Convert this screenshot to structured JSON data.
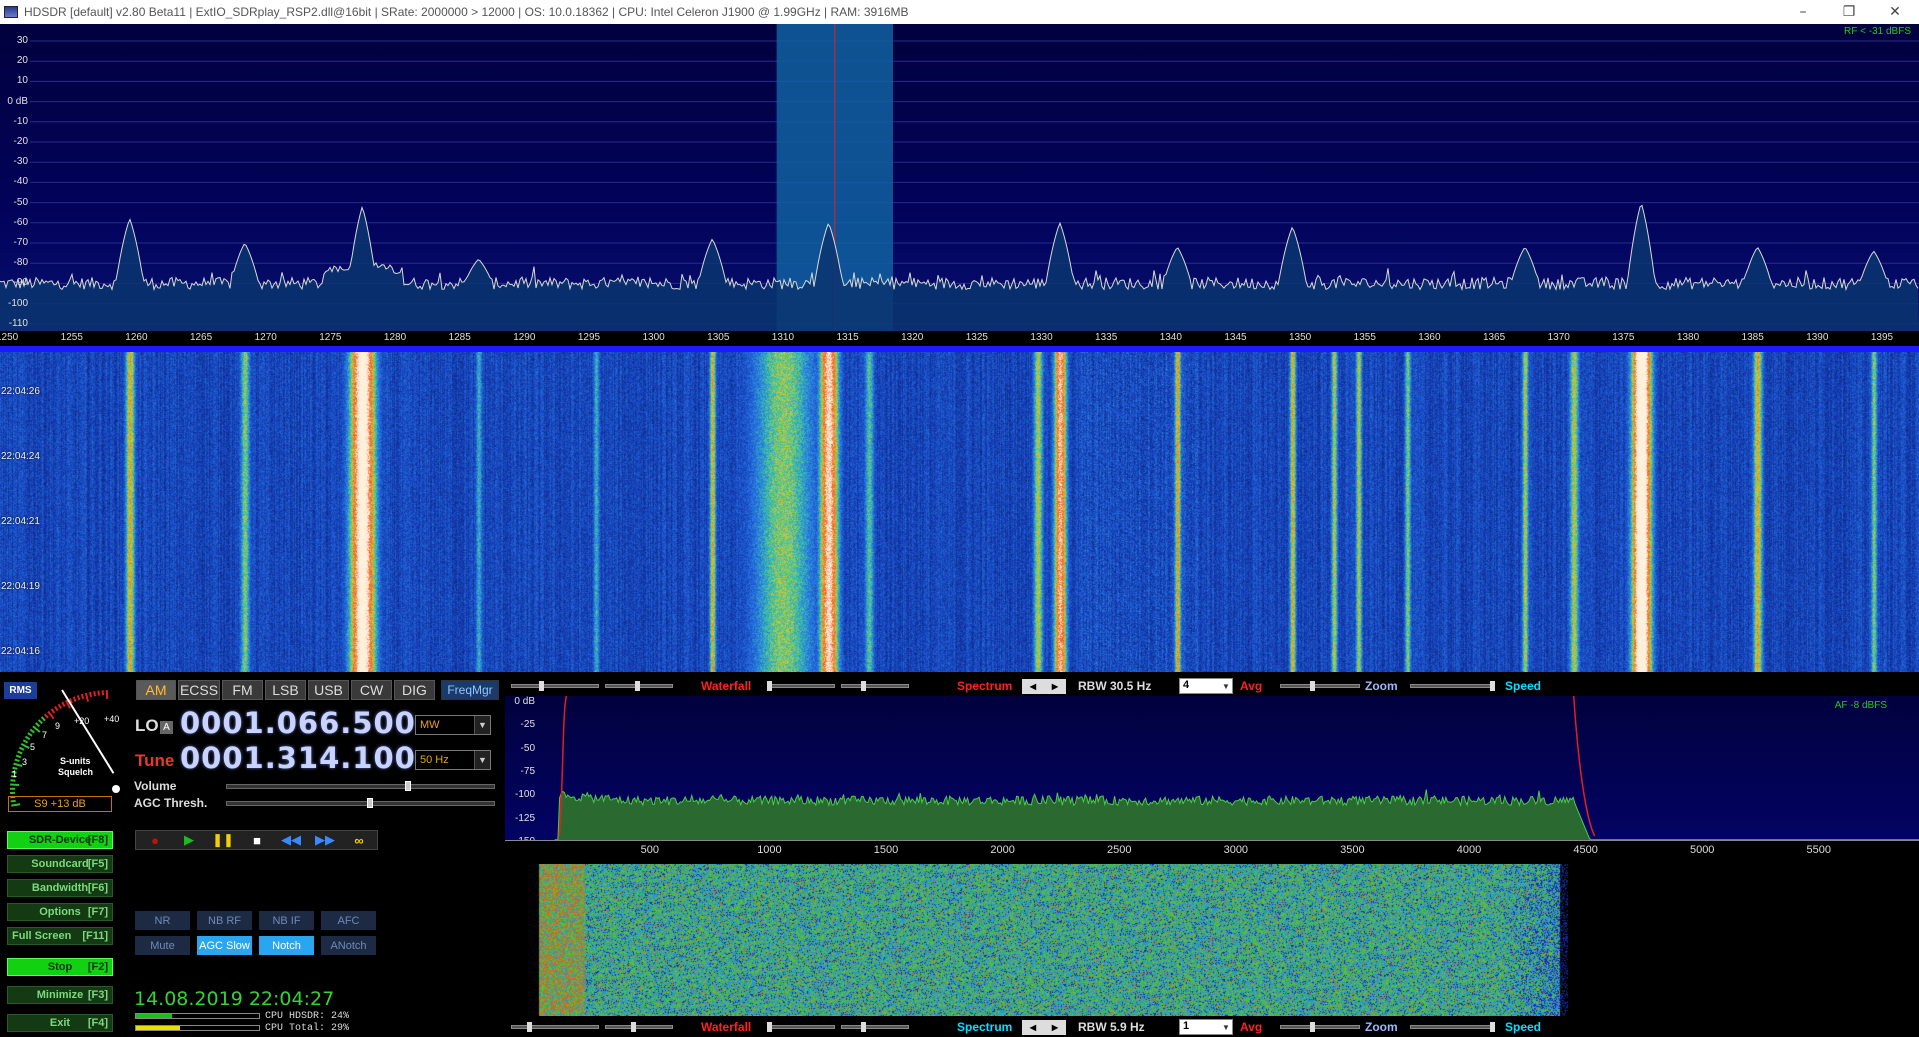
{
  "window": {
    "title": "HDSDR  [default]  v2.80 Beta11  |  ExtIO_SDRplay_RSP2.dll@16bit  |  SRate: 2000000 > 12000  |  OS: 10.0.18362   |  CPU: Intel Celeron  J1900  @ 1.99GHz  |  RAM: 3916MB",
    "minimize_icon": "minimize-icon",
    "restore_icon": "restore-icon",
    "close_icon": "close-icon"
  },
  "spectrum": {
    "rf_dbfs": "RF < -31 dBFS",
    "db_labels": [
      "30",
      "20",
      "10",
      "0 dB",
      "-10",
      "-20",
      "-30",
      "-40",
      "-50",
      "-60",
      "-70",
      "-80",
      "-90",
      "-100",
      "-110"
    ],
    "freq_labels": [
      "1250",
      "1255",
      "1260",
      "1265",
      "1270",
      "1275",
      "1280",
      "1285",
      "1290",
      "1295",
      "1300",
      "1305",
      "1310",
      "1315",
      "1320",
      "1325",
      "1330",
      "1335",
      "1340",
      "1345",
      "1350",
      "1355",
      "1360",
      "1365",
      "1370",
      "1375",
      "1380",
      "1385",
      "1390",
      "1395"
    ],
    "tuned_khz": 1314.1,
    "filter_band_khz": [
      1309.6,
      1318.6
    ]
  },
  "waterfall": {
    "time_labels": [
      "22:04:26",
      "22:04:24",
      "22:04:21",
      "22:04:19",
      "22:04:16"
    ]
  },
  "meter": {
    "rms_label": "RMS",
    "scale": [
      "1",
      "3",
      "5",
      "7",
      "9",
      "+20",
      "+40"
    ],
    "caption_line1": "S-units",
    "caption_line2": "Squelch",
    "level": "S9 +13 dB",
    "needle_fraction": 0.84
  },
  "modes": {
    "items": [
      "AM",
      "ECSS",
      "FM",
      "LSB",
      "USB",
      "CW",
      "DIG"
    ],
    "active": "AM",
    "freqmgr": "FreqMgr"
  },
  "lo": {
    "label": "LO",
    "sub": "A",
    "value": "0001.066.500",
    "band": "MW"
  },
  "tune": {
    "label": "Tune",
    "value": "0001.314.100",
    "step": "50 Hz"
  },
  "sliders": {
    "volume": "Volume",
    "agc": "AGC Thresh."
  },
  "side_buttons": [
    {
      "label": "SDR-Device",
      "key": "[F8]",
      "on": true
    },
    {
      "label": "Soundcard",
      "key": "[F5]",
      "on": false
    },
    {
      "label": "Bandwidth",
      "key": "[F6]",
      "on": false
    },
    {
      "label": "Options",
      "key": "[F7]",
      "on": false
    },
    {
      "label": "Full Screen",
      "key": "[F11]",
      "on": false
    },
    {
      "label": "Stop",
      "key": "[F2]",
      "on": true
    },
    {
      "label": "Minimize",
      "key": "[F3]",
      "on": false
    },
    {
      "label": "Exit",
      "key": "[F4]",
      "on": false
    }
  ],
  "transport": {
    "record_icon": "record-icon",
    "play_icon": "play-icon",
    "pause_icon": "pause-icon",
    "stop_icon": "stop-icon",
    "rewind_icon": "rewind-icon",
    "forward_icon": "fast-forward-icon",
    "loop_icon": "loop-icon"
  },
  "dsp": {
    "row1": [
      "NR",
      "NB RF",
      "NB IF",
      "AFC"
    ],
    "row2": [
      "Mute",
      "AGC Slow",
      "Notch",
      "ANotch"
    ],
    "row2_on": [
      false,
      true,
      true,
      false
    ]
  },
  "status": {
    "datetime": "14.08.2019 22:04:27",
    "cpu_hdsdr": "CPU HDSDR: 24%",
    "cpu_total": "CPU Total: 29%",
    "cpu_hdsdr_pct": 24,
    "cpu_total_pct": 29
  },
  "audio_toolbar_top": {
    "waterfall": "Waterfall",
    "spectrum": "Spectrum",
    "rbw": "RBW 30.5 Hz",
    "avg_value": "4",
    "avg": "Avg",
    "zoom": "Zoom",
    "speed": "Speed"
  },
  "audio_toolbar_bottom": {
    "waterfall": "Waterfall",
    "spectrum": "Spectrum",
    "rbw": "RBW  5.9 Hz",
    "avg_value": "1",
    "avg": "Avg",
    "zoom": "Zoom",
    "speed": "Speed"
  },
  "audio_spectrum": {
    "af_dbfs": "AF  -8 dBFS",
    "db_labels": [
      "0 dB",
      "-25",
      "-50",
      "-75",
      "-100",
      "-125",
      "-150"
    ],
    "freq_labels": [
      "500",
      "1000",
      "1500",
      "2000",
      "2500",
      "3000",
      "3500",
      "4000",
      "4500",
      "5000",
      "5500"
    ]
  },
  "colors": {
    "accent_green": "#12d012",
    "waterfall_red": "#ff2020",
    "spectrum_red": "#ff2020",
    "speed_cyan": "#00e0ff",
    "zoom_blue": "#9ab8ff",
    "freq_digits": "#c8d4ff"
  }
}
